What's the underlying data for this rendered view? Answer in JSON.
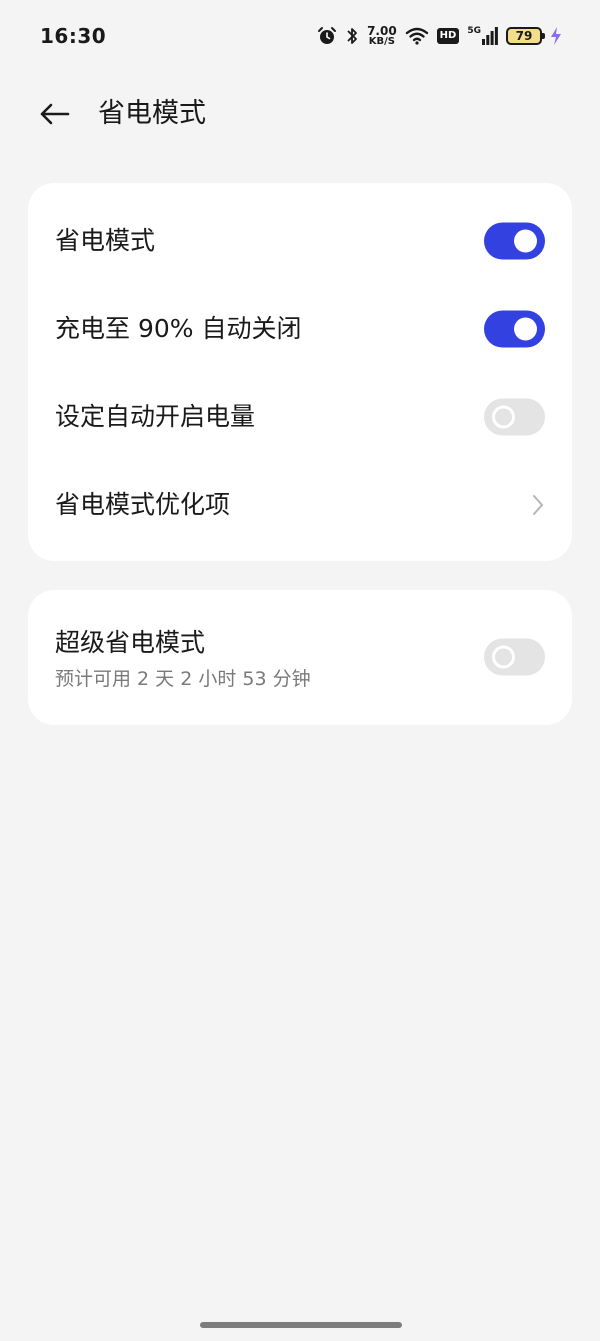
{
  "status_bar": {
    "time": "16:30",
    "net_speed_value": "7.00",
    "net_speed_unit": "KB/S",
    "hd_label": "HD",
    "network_type": "5G",
    "battery_level": "79",
    "icons": [
      "alarm-icon",
      "bluetooth-icon",
      "wifi-icon",
      "hd-icon",
      "signal-icon",
      "battery-icon",
      "charging-icon"
    ],
    "battery_color": "#f1de8a",
    "charging_color": "#8a6cf0"
  },
  "header": {
    "back_icon": "arrow-left-icon",
    "title": "省电模式"
  },
  "settings_group_1": {
    "items": [
      {
        "label": "省电模式",
        "control": "toggle",
        "on": true
      },
      {
        "label": "充电至 90% 自动关闭",
        "control": "toggle",
        "on": true
      },
      {
        "label": "设定自动开启电量",
        "control": "toggle",
        "on": false
      },
      {
        "label": "省电模式优化项",
        "control": "chevron-right-icon"
      }
    ]
  },
  "settings_group_2": {
    "title": "超级省电模式",
    "subtitle": "预计可用 2 天 2 小时 53 分钟",
    "control": "toggle",
    "on": false
  },
  "colors": {
    "accent": "#3341e0",
    "toggle_off": "#e4e4e4",
    "background": "#f4f4f4",
    "card": "#ffffff"
  }
}
